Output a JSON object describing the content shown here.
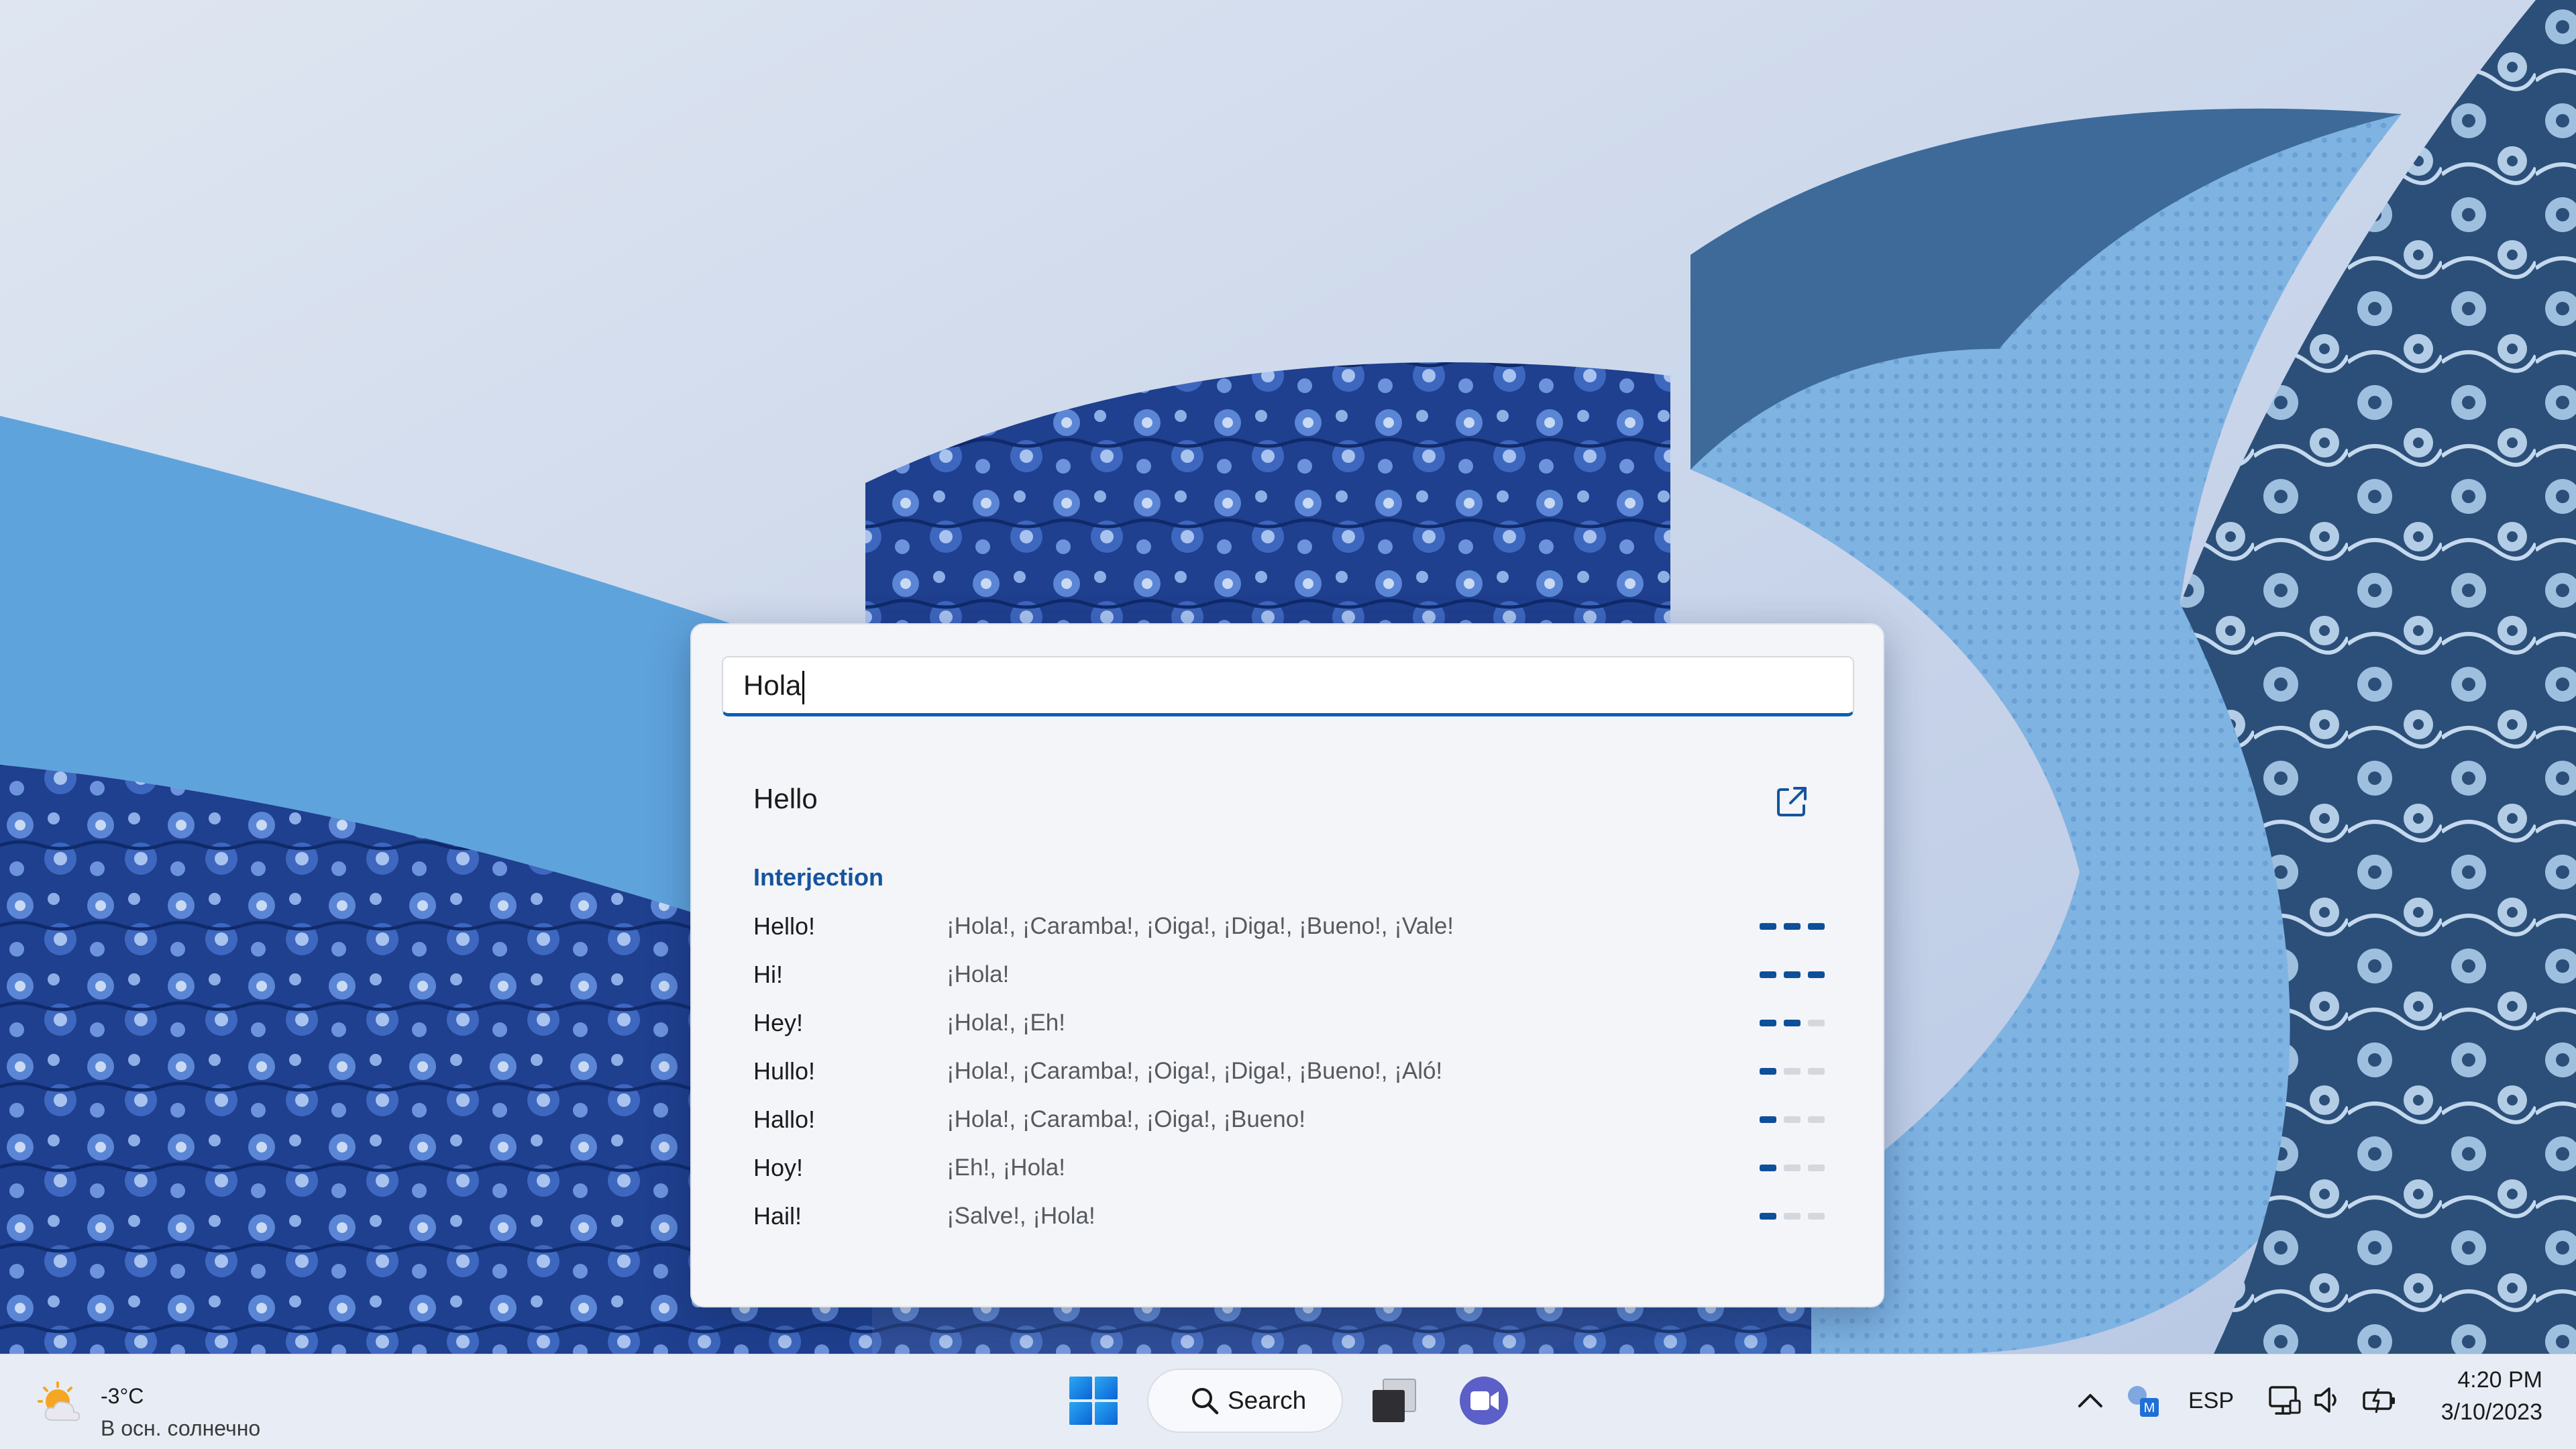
{
  "dictionary": {
    "query": "Hola",
    "headword": "Hello",
    "part_of_speech": "Interjection",
    "entries": [
      {
        "term": "Hello!",
        "translations": "¡Hola!, ¡Caramba!, ¡Oiga!, ¡Diga!, ¡Bueno!, ¡Vale!",
        "frequency": 3
      },
      {
        "term": "Hi!",
        "translations": "¡Hola!",
        "frequency": 3
      },
      {
        "term": "Hey!",
        "translations": "¡Hola!, ¡Eh!",
        "frequency": 2
      },
      {
        "term": "Hullo!",
        "translations": "¡Hola!, ¡Caramba!, ¡Oiga!, ¡Diga!, ¡Bueno!, ¡Aló!",
        "frequency": 1
      },
      {
        "term": "Hallo!",
        "translations": "¡Hola!, ¡Caramba!, ¡Oiga!, ¡Bueno!",
        "frequency": 1
      },
      {
        "term": "Hoy!",
        "translations": "¡Eh!, ¡Hola!",
        "frequency": 1
      },
      {
        "term": "Hail!",
        "translations": "¡Salve!, ¡Hola!",
        "frequency": 1
      }
    ],
    "accent_color": "#0a5fb4",
    "frequency_color": "#0d4f9a"
  },
  "taskbar": {
    "weather": {
      "temperature": "-3°C",
      "description": "В осн. солнечно"
    },
    "search_label": "Search",
    "language": "ESP",
    "time": "4:20 PM",
    "date": "3/10/2023",
    "icons": [
      "windows-start-icon",
      "search-icon",
      "task-view-icon",
      "meet-icon",
      "chevron-up-icon",
      "tray-app-icon",
      "network-icon",
      "volume-icon",
      "battery-icon"
    ]
  }
}
